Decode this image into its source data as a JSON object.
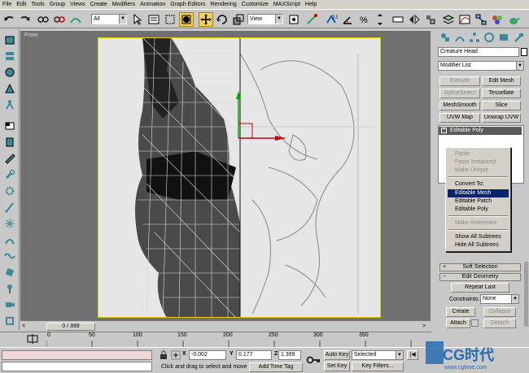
{
  "menu": [
    "File",
    "Edit",
    "Tools",
    "Group",
    "Views",
    "Create",
    "Modifiers",
    "Animation",
    "Graph Editors",
    "Rendering",
    "Customize",
    "MAXScript",
    "Help"
  ],
  "toolbar": {
    "selection_filter": "All",
    "reference_coord": "View"
  },
  "viewport": {
    "label": "Front"
  },
  "command_panel": {
    "object_name": "Creature Head",
    "modifier_list": "Modifier List",
    "buttons": [
      {
        "label": "Extrude",
        "enabled": false
      },
      {
        "label": "Edit Mesh",
        "enabled": true
      },
      {
        "label": "SplineSelect",
        "enabled": false
      },
      {
        "label": "Tessellate",
        "enabled": true
      },
      {
        "label": "MeshSmooth",
        "enabled": true
      },
      {
        "label": "Slice",
        "enabled": true
      },
      {
        "label": "UVW Map",
        "enabled": true
      },
      {
        "label": "Unwrap UVW",
        "enabled": true
      }
    ],
    "stack_item": "Editable Poly",
    "rollouts": {
      "soft_selection": "Soft Selection",
      "edit_geometry": "Edit Geometry"
    },
    "repeat_last": "Repeat Last",
    "constraints_label": "Constraints:",
    "constraints_value": "None",
    "create": "Create",
    "collapse": "Collapse",
    "attach": "Attach",
    "detach": "Detach"
  },
  "context_menu": {
    "items": [
      {
        "label": "Paste",
        "enabled": false,
        "selected": false
      },
      {
        "label": "Paste Instanced",
        "enabled": false,
        "selected": false
      },
      {
        "label": "Make Unique",
        "enabled": false,
        "selected": false
      },
      {
        "label": "Convert To:",
        "enabled": true,
        "selected": false
      },
      {
        "label": "Editable Mesh",
        "enabled": true,
        "selected": true
      },
      {
        "label": "Editable Patch",
        "enabled": true,
        "selected": false
      },
      {
        "label": "Editable Poly",
        "enabled": true,
        "selected": false
      },
      {
        "label": "Make Reference",
        "enabled": false,
        "selected": false
      },
      {
        "label": "Show All Subtrees",
        "enabled": true,
        "selected": false
      },
      {
        "label": "Hide All Subtrees",
        "enabled": true,
        "selected": false
      }
    ]
  },
  "timeline": {
    "frame": "0 / 399",
    "ticks": [
      "0",
      "50",
      "100",
      "150",
      "200",
      "250",
      "300",
      "350"
    ]
  },
  "status": {
    "x_label": "X",
    "x_value": "-0.002",
    "y_label": "Y",
    "y_value": "0.177",
    "z_label": "Z",
    "z_value": "1.399",
    "prompt": "Click and drag to select and move",
    "add_time_tag": "Add Time Tag",
    "auto_key": "Auto Key",
    "set_key": "Set Key",
    "selected": "Selected",
    "key_filters": "Key Filters..."
  },
  "watermark": {
    "brand": "CG时代",
    "url": "www.cgtime.com"
  },
  "colors": {
    "accent_selected": "#0a246a",
    "active_tool": "#f0d060",
    "viewport_bg": "#707070",
    "viewport_border": "#e0d000"
  }
}
